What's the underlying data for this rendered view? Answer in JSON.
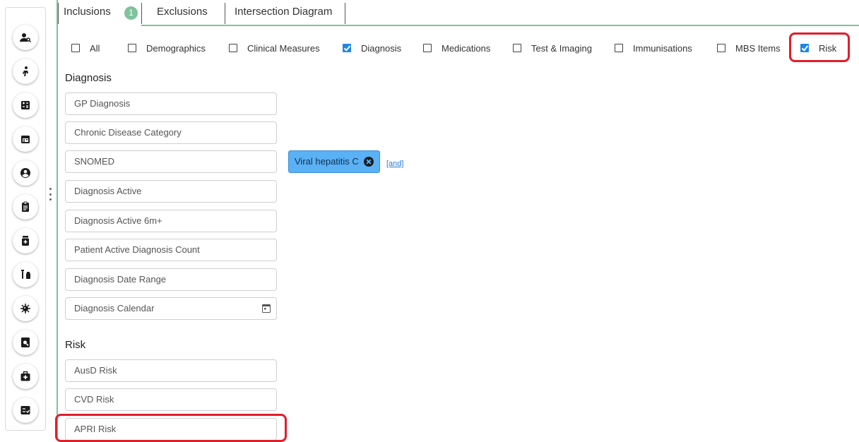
{
  "tabs": [
    {
      "label": "Inclusions",
      "badge": "1"
    },
    {
      "label": "Exclusions"
    },
    {
      "label": "Intersection Diagram"
    }
  ],
  "filters": [
    {
      "label": "All",
      "checked": false
    },
    {
      "label": "Demographics",
      "checked": false
    },
    {
      "label": "Clinical Measures",
      "checked": false
    },
    {
      "label": "Diagnosis",
      "checked": true
    },
    {
      "label": "Medications",
      "checked": false
    },
    {
      "label": "Test & Imaging",
      "checked": false
    },
    {
      "label": "Immunisations",
      "checked": false
    },
    {
      "label": "MBS Items",
      "checked": false
    },
    {
      "label": "Risk",
      "checked": true
    }
  ],
  "diagnosis": {
    "heading": "Diagnosis",
    "fields": [
      "GP Diagnosis",
      "Chronic Disease Category",
      "SNOMED",
      "Diagnosis Active",
      "Diagnosis Active 6m+",
      "Patient Active Diagnosis Count",
      "Diagnosis Date Range",
      "Diagnosis Calendar"
    ],
    "snomed_chip": "Viral hepatitis C",
    "and_link": "[and]"
  },
  "risk": {
    "heading": "Risk",
    "fields": [
      "AusD Risk",
      "CVD Risk",
      "APRI Risk"
    ]
  },
  "colors": {
    "accent_green": "#7ec39c",
    "chip_blue": "#5ab1f5",
    "checkbox_blue": "#1e88e5",
    "highlight_red": "#e11d2b"
  },
  "rail_icons": [
    "patient-search-icon",
    "person-walking-icon",
    "calculator-icon",
    "calendar-icon",
    "account-circle-icon",
    "clipboard-icon",
    "medicine-icon",
    "vials-icon",
    "virus-icon",
    "document-search-icon",
    "medical-bag-icon",
    "checklist-icon"
  ]
}
